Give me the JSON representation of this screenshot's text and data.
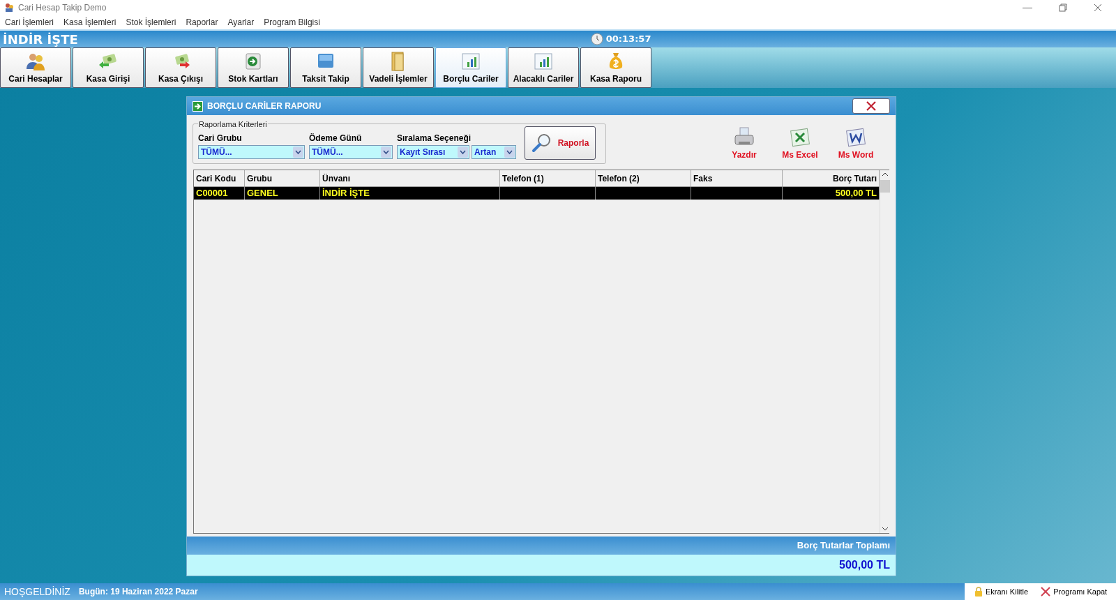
{
  "window": {
    "title": "Cari Hesap Takip Demo"
  },
  "menu": [
    "Cari İşlemleri",
    "Kasa İşlemleri",
    "Stok İşlemleri",
    "Raporlar",
    "Ayarlar",
    "Program Bilgisi"
  ],
  "header": {
    "company": "İNDİR İŞTE",
    "clock": "00:13:57"
  },
  "toolbar": [
    {
      "label": "Cari Hesaplar",
      "kind": "users",
      "selected": false
    },
    {
      "label": "Kasa Girişi",
      "kind": "cash-in",
      "selected": false
    },
    {
      "label": "Kasa Çıkışı",
      "kind": "cash-out",
      "selected": false
    },
    {
      "label": "Stok Kartları",
      "kind": "card",
      "selected": false
    },
    {
      "label": "Taksit Takip",
      "kind": "tile",
      "selected": false
    },
    {
      "label": "Vadeli İşlemler",
      "kind": "folder",
      "selected": false
    },
    {
      "label": "Borçlu Cariler",
      "kind": "chart",
      "selected": true
    },
    {
      "label": "Alacaklı Cariler",
      "kind": "chart",
      "selected": false
    },
    {
      "label": "Kasa Raporu",
      "kind": "moneybag",
      "selected": false
    }
  ],
  "dialog": {
    "title": "BORÇLU CARİLER RAPORU",
    "criteria": {
      "legend": "Raporlama Kriterleri",
      "fields": [
        {
          "label": "Cari Grubu",
          "values": [
            "TÜMÜ..."
          ]
        },
        {
          "label": "Ödeme Günü",
          "values": [
            "TÜMÜ..."
          ]
        },
        {
          "label": "Sıralama Seçeneği",
          "values": [
            "Kayıt Sırası",
            "Artan"
          ]
        }
      ],
      "button": "Raporla"
    },
    "exports": [
      {
        "label": "Yazdır",
        "kind": "printer"
      },
      {
        "label": "Ms Excel",
        "kind": "excel"
      },
      {
        "label": "Ms Word",
        "kind": "word"
      }
    ],
    "table": {
      "columns": [
        "Cari Kodu",
        "Grubu",
        "Ünvanı",
        "Telefon (1)",
        "Telefon (2)",
        "Faks",
        "Borç Tutarı"
      ],
      "rows": [
        {
          "cells": [
            "C00001",
            "GENEL",
            "İNDİR İŞTE",
            "",
            "",
            "",
            "500,00 TL"
          ],
          "selected": true
        }
      ]
    },
    "total_label": "Borç Tutarlar Toplamı",
    "total_value": "500,00 TL"
  },
  "status_bar": {
    "welcome": "HOŞGELDİNİZ",
    "date": "Bugün: 19 Haziran 2022 Pazar",
    "actions": [
      {
        "label": "Ekranı Kilitle",
        "kind": "lock"
      },
      {
        "label": "Programı Kapat",
        "kind": "close"
      }
    ]
  }
}
